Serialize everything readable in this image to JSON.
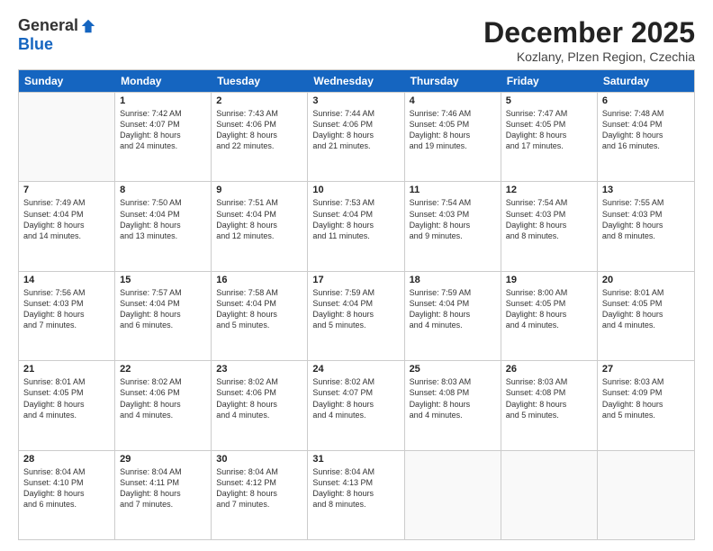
{
  "logo": {
    "general": "General",
    "blue": "Blue"
  },
  "header": {
    "month": "December 2025",
    "location": "Kozlany, Plzen Region, Czechia"
  },
  "days": [
    "Sunday",
    "Monday",
    "Tuesday",
    "Wednesday",
    "Thursday",
    "Friday",
    "Saturday"
  ],
  "weeks": [
    [
      {
        "day": null,
        "text": ""
      },
      {
        "day": "1",
        "text": "Sunrise: 7:42 AM\nSunset: 4:07 PM\nDaylight: 8 hours\nand 24 minutes."
      },
      {
        "day": "2",
        "text": "Sunrise: 7:43 AM\nSunset: 4:06 PM\nDaylight: 8 hours\nand 22 minutes."
      },
      {
        "day": "3",
        "text": "Sunrise: 7:44 AM\nSunset: 4:06 PM\nDaylight: 8 hours\nand 21 minutes."
      },
      {
        "day": "4",
        "text": "Sunrise: 7:46 AM\nSunset: 4:05 PM\nDaylight: 8 hours\nand 19 minutes."
      },
      {
        "day": "5",
        "text": "Sunrise: 7:47 AM\nSunset: 4:05 PM\nDaylight: 8 hours\nand 17 minutes."
      },
      {
        "day": "6",
        "text": "Sunrise: 7:48 AM\nSunset: 4:04 PM\nDaylight: 8 hours\nand 16 minutes."
      }
    ],
    [
      {
        "day": "7",
        "text": "Sunrise: 7:49 AM\nSunset: 4:04 PM\nDaylight: 8 hours\nand 14 minutes."
      },
      {
        "day": "8",
        "text": "Sunrise: 7:50 AM\nSunset: 4:04 PM\nDaylight: 8 hours\nand 13 minutes."
      },
      {
        "day": "9",
        "text": "Sunrise: 7:51 AM\nSunset: 4:04 PM\nDaylight: 8 hours\nand 12 minutes."
      },
      {
        "day": "10",
        "text": "Sunrise: 7:53 AM\nSunset: 4:04 PM\nDaylight: 8 hours\nand 11 minutes."
      },
      {
        "day": "11",
        "text": "Sunrise: 7:54 AM\nSunset: 4:03 PM\nDaylight: 8 hours\nand 9 minutes."
      },
      {
        "day": "12",
        "text": "Sunrise: 7:54 AM\nSunset: 4:03 PM\nDaylight: 8 hours\nand 8 minutes."
      },
      {
        "day": "13",
        "text": "Sunrise: 7:55 AM\nSunset: 4:03 PM\nDaylight: 8 hours\nand 8 minutes."
      }
    ],
    [
      {
        "day": "14",
        "text": "Sunrise: 7:56 AM\nSunset: 4:03 PM\nDaylight: 8 hours\nand 7 minutes."
      },
      {
        "day": "15",
        "text": "Sunrise: 7:57 AM\nSunset: 4:04 PM\nDaylight: 8 hours\nand 6 minutes."
      },
      {
        "day": "16",
        "text": "Sunrise: 7:58 AM\nSunset: 4:04 PM\nDaylight: 8 hours\nand 5 minutes."
      },
      {
        "day": "17",
        "text": "Sunrise: 7:59 AM\nSunset: 4:04 PM\nDaylight: 8 hours\nand 5 minutes."
      },
      {
        "day": "18",
        "text": "Sunrise: 7:59 AM\nSunset: 4:04 PM\nDaylight: 8 hours\nand 4 minutes."
      },
      {
        "day": "19",
        "text": "Sunrise: 8:00 AM\nSunset: 4:05 PM\nDaylight: 8 hours\nand 4 minutes."
      },
      {
        "day": "20",
        "text": "Sunrise: 8:01 AM\nSunset: 4:05 PM\nDaylight: 8 hours\nand 4 minutes."
      }
    ],
    [
      {
        "day": "21",
        "text": "Sunrise: 8:01 AM\nSunset: 4:05 PM\nDaylight: 8 hours\nand 4 minutes."
      },
      {
        "day": "22",
        "text": "Sunrise: 8:02 AM\nSunset: 4:06 PM\nDaylight: 8 hours\nand 4 minutes."
      },
      {
        "day": "23",
        "text": "Sunrise: 8:02 AM\nSunset: 4:06 PM\nDaylight: 8 hours\nand 4 minutes."
      },
      {
        "day": "24",
        "text": "Sunrise: 8:02 AM\nSunset: 4:07 PM\nDaylight: 8 hours\nand 4 minutes."
      },
      {
        "day": "25",
        "text": "Sunrise: 8:03 AM\nSunset: 4:08 PM\nDaylight: 8 hours\nand 4 minutes."
      },
      {
        "day": "26",
        "text": "Sunrise: 8:03 AM\nSunset: 4:08 PM\nDaylight: 8 hours\nand 5 minutes."
      },
      {
        "day": "27",
        "text": "Sunrise: 8:03 AM\nSunset: 4:09 PM\nDaylight: 8 hours\nand 5 minutes."
      }
    ],
    [
      {
        "day": "28",
        "text": "Sunrise: 8:04 AM\nSunset: 4:10 PM\nDaylight: 8 hours\nand 6 minutes."
      },
      {
        "day": "29",
        "text": "Sunrise: 8:04 AM\nSunset: 4:11 PM\nDaylight: 8 hours\nand 7 minutes."
      },
      {
        "day": "30",
        "text": "Sunrise: 8:04 AM\nSunset: 4:12 PM\nDaylight: 8 hours\nand 7 minutes."
      },
      {
        "day": "31",
        "text": "Sunrise: 8:04 AM\nSunset: 4:13 PM\nDaylight: 8 hours\nand 8 minutes."
      },
      {
        "day": null,
        "text": ""
      },
      {
        "day": null,
        "text": ""
      },
      {
        "day": null,
        "text": ""
      }
    ]
  ]
}
